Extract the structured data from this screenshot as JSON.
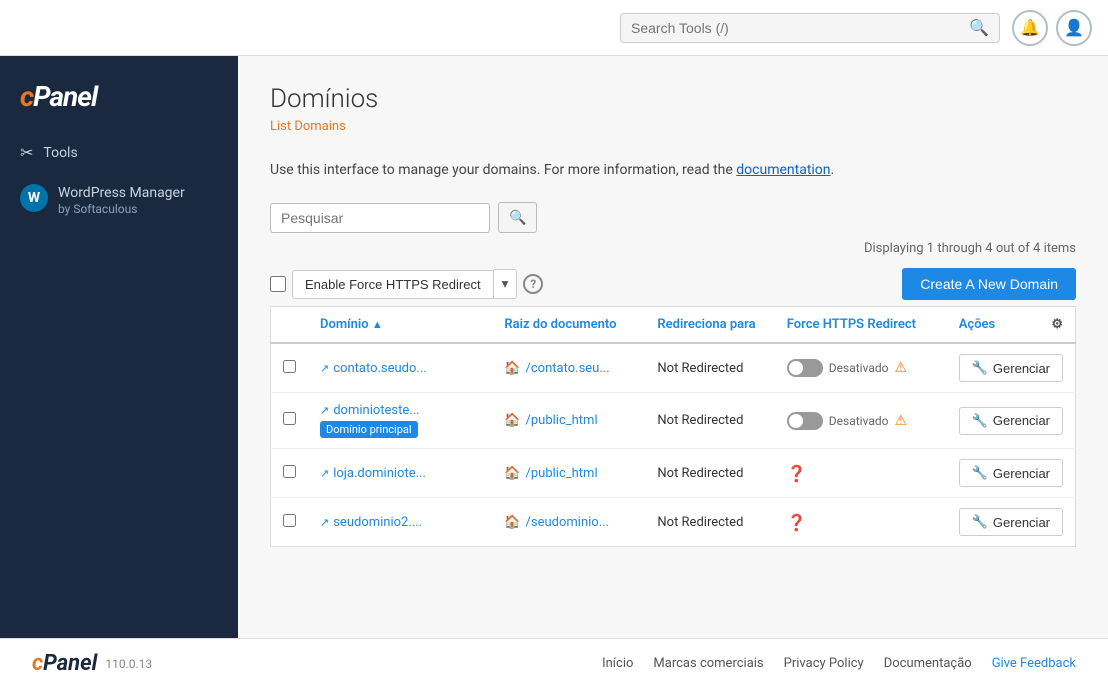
{
  "topbar": {
    "search_placeholder": "Search Tools (/)",
    "search_label": "Search Tools (/)"
  },
  "sidebar": {
    "logo": "cPanel",
    "items": [
      {
        "id": "tools",
        "label": "Tools",
        "icon": "✂"
      },
      {
        "id": "wordpress-manager",
        "label": "WordPress Manager",
        "sublabel": "by Softaculous"
      }
    ]
  },
  "main": {
    "page_title": "Domínios",
    "breadcrumb": "List Domains",
    "description_text": "Use this interface to manage your domains. For more information, read the ",
    "description_link": "documentation",
    "description_end": ".",
    "search_placeholder": "Pesquisar",
    "displaying": "Displaying 1 through 4 out of 4 items",
    "enable_https_label": "Enable Force HTTPS Redirect",
    "create_domain_btn": "Create A New Domain",
    "columns": {
      "domain": "Domínio",
      "root": "Raiz do documento",
      "redirect": "Redireciona para",
      "https": "Force HTTPS Redirect",
      "actions": "Ações"
    },
    "rows": [
      {
        "id": 1,
        "domain": "contato.seudo...",
        "root": "/contato.seu...",
        "redirect": "Not Redirected",
        "https_status": "Desativado",
        "is_main": false,
        "manage_label": "Gerenciar"
      },
      {
        "id": 2,
        "domain": "dominioteste...",
        "root": "/public_html",
        "redirect": "Not Redirected",
        "https_status": "Desativado",
        "is_main": true,
        "main_badge": "Domínio principal",
        "manage_label": "Gerenciar"
      },
      {
        "id": 3,
        "domain": "loja.dominiote...",
        "root": "/public_html",
        "redirect": "Not Redirected",
        "https_status": "",
        "is_main": false,
        "manage_label": "Gerenciar"
      },
      {
        "id": 4,
        "domain": "seudominio2....",
        "root": "/seudominio...",
        "redirect": "Not Redirected",
        "https_status": "",
        "is_main": false,
        "manage_label": "Gerenciar"
      }
    ]
  },
  "footer": {
    "logo": "cPanel",
    "version": "110.0.13",
    "links": [
      "Início",
      "Marcas comerciais",
      "Privacy Policy",
      "Documentação",
      "Give Feedback"
    ]
  }
}
